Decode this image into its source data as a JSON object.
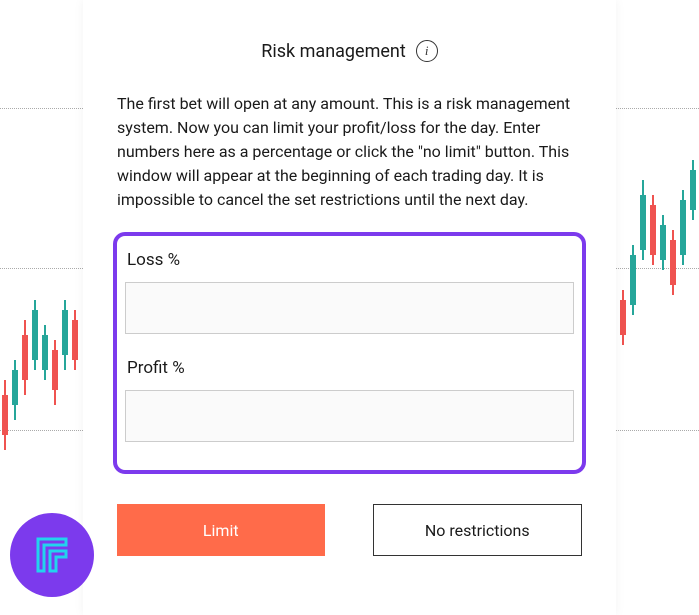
{
  "modal": {
    "title": "Risk management",
    "description": "The first bet will open at any amount. This is a risk management system. Now you can limit your profit/loss for the day. Enter numbers here as a percentage or click the \"no limit\" button. This window will appear at the beginning of each trading day. It is impossible to cancel the set restrictions until the next day.",
    "loss_label": "Loss %",
    "profit_label": "Profit %",
    "loss_value": "",
    "profit_value": "",
    "limit_button": "Limit",
    "no_restrictions_button": "No restrictions"
  },
  "info_icon_glyph": "i"
}
